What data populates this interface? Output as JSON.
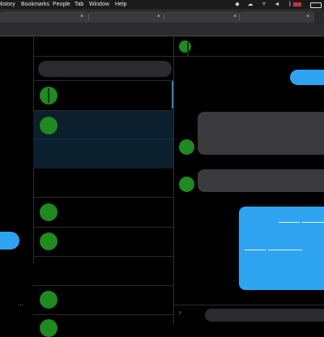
{
  "menubar": {
    "items": [
      {
        "id": "history",
        "label": "History"
      },
      {
        "id": "bookmarks",
        "label": "Bookmarks"
      },
      {
        "id": "people",
        "label": "People"
      },
      {
        "id": "tab",
        "label": "Tab"
      },
      {
        "id": "window",
        "label": "Window"
      },
      {
        "id": "help",
        "label": "Help"
      }
    ],
    "status_icons": [
      "dropbox-icon",
      "cloud-icon",
      "siri-icon",
      "timemachine-icon",
      "volume-icon",
      "bluetooth-icon",
      "flag-us-icon",
      "battery-icon"
    ]
  },
  "tabs": [
    {
      "id": "tab-1",
      "close": "×"
    },
    {
      "id": "tab-2",
      "close": "×"
    },
    {
      "id": "tab-3",
      "close": "×"
    },
    {
      "id": "tab-4",
      "close": "×"
    }
  ],
  "sidebar": {
    "more_label": "···"
  },
  "colors": {
    "accent_blue": "#2ea4f0",
    "avatar_green": "#1f8a1f",
    "bubble_gray": "#3a3a3c",
    "background": "#000000"
  },
  "composer": {
    "arrow": "›"
  }
}
